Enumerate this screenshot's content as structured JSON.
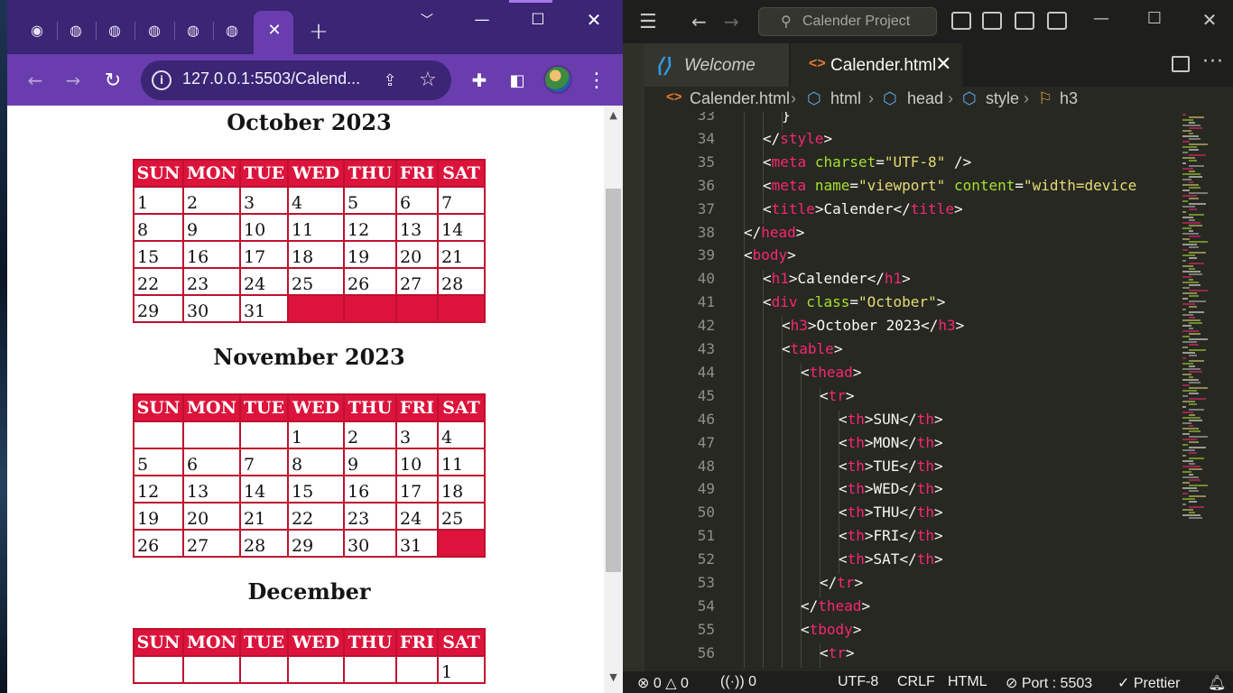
{
  "browser": {
    "tab_count_inactive": 5,
    "new_tab_label": "+",
    "url": "127.0.0.1:5503/Calend...",
    "icons": {
      "back": "arrow-left-icon",
      "forward": "arrow-right-icon",
      "reload": "reload-icon",
      "info": "info-icon",
      "share": "share-icon",
      "bookmark": "star-icon",
      "extensions": "puzzle-icon",
      "side_panel": "side-panel-icon",
      "menu": "kebab-icon"
    },
    "colors": {
      "tabstrip": "#3b2575",
      "toolbar": "#6a3dae"
    }
  },
  "page": {
    "accent": "#dc143c",
    "weekdays": [
      "SUN",
      "MON",
      "TUE",
      "WED",
      "THU",
      "FRI",
      "SAT"
    ],
    "months": [
      {
        "title": "October 2023",
        "weeks": [
          [
            "1",
            "2",
            "3",
            "4",
            "5",
            "6",
            "7"
          ],
          [
            "8",
            "9",
            "10",
            "11",
            "12",
            "13",
            "14"
          ],
          [
            "15",
            "16",
            "17",
            "18",
            "19",
            "20",
            "21"
          ],
          [
            "22",
            "23",
            "24",
            "25",
            "26",
            "27",
            "28"
          ],
          [
            "29",
            "30",
            "31",
            "",
            "",
            "",
            ""
          ]
        ]
      },
      {
        "title": "November 2023",
        "weeks": [
          [
            "",
            "",
            "",
            "1",
            "2",
            "3",
            "4"
          ],
          [
            "5",
            "6",
            "7",
            "8",
            "9",
            "10",
            "11"
          ],
          [
            "12",
            "13",
            "14",
            "15",
            "16",
            "17",
            "18"
          ],
          [
            "19",
            "20",
            "21",
            "22",
            "23",
            "24",
            "25"
          ],
          [
            "26",
            "27",
            "28",
            "29",
            "30",
            "31",
            ""
          ]
        ]
      },
      {
        "title": "December",
        "weeks": [
          [
            "",
            "",
            "",
            "",
            "",
            "",
            "1"
          ]
        ]
      }
    ]
  },
  "vscode": {
    "search_placeholder": "Calender Project",
    "tabs": [
      {
        "label": "Welcome",
        "active": false
      },
      {
        "label": "Calender.html",
        "active": true
      }
    ],
    "breadcrumbs": [
      "Calender.html",
      "html",
      "head",
      "style",
      "h3"
    ],
    "code_lines": [
      {
        "n": "33",
        "indent": 3,
        "tokens": [
          [
            "p",
            "}"
          ]
        ]
      },
      {
        "n": "34",
        "indent": 2,
        "tokens": [
          [
            "p",
            "</"
          ],
          [
            "t",
            "style"
          ],
          [
            "p",
            ">"
          ]
        ]
      },
      {
        "n": "35",
        "indent": 2,
        "tokens": [
          [
            "p",
            "<"
          ],
          [
            "t",
            "meta"
          ],
          [
            "p",
            " "
          ],
          [
            "a",
            "charset"
          ],
          [
            "p",
            "="
          ],
          [
            "s",
            "\"UTF-8\""
          ],
          [
            "p",
            " />"
          ]
        ]
      },
      {
        "n": "36",
        "indent": 2,
        "tokens": [
          [
            "p",
            "<"
          ],
          [
            "t",
            "meta"
          ],
          [
            "p",
            " "
          ],
          [
            "a",
            "name"
          ],
          [
            "p",
            "="
          ],
          [
            "s",
            "\"viewport\""
          ],
          [
            "p",
            " "
          ],
          [
            "a",
            "content"
          ],
          [
            "p",
            "="
          ],
          [
            "s",
            "\"width=device"
          ]
        ]
      },
      {
        "n": "37",
        "indent": 2,
        "tokens": [
          [
            "p",
            "<"
          ],
          [
            "t",
            "title"
          ],
          [
            "p",
            ">Calender</"
          ],
          [
            "t",
            "title"
          ],
          [
            "p",
            ">"
          ]
        ]
      },
      {
        "n": "38",
        "indent": 1,
        "tokens": [
          [
            "p",
            "</"
          ],
          [
            "t",
            "head"
          ],
          [
            "p",
            ">"
          ]
        ]
      },
      {
        "n": "39",
        "indent": 1,
        "tokens": [
          [
            "p",
            "<"
          ],
          [
            "t",
            "body"
          ],
          [
            "p",
            ">"
          ]
        ]
      },
      {
        "n": "40",
        "indent": 2,
        "tokens": [
          [
            "p",
            "<"
          ],
          [
            "t",
            "h1"
          ],
          [
            "p",
            ">Calender</"
          ],
          [
            "t",
            "h1"
          ],
          [
            "p",
            ">"
          ]
        ]
      },
      {
        "n": "41",
        "indent": 2,
        "tokens": [
          [
            "p",
            "<"
          ],
          [
            "t",
            "div"
          ],
          [
            "p",
            " "
          ],
          [
            "a",
            "class"
          ],
          [
            "p",
            "="
          ],
          [
            "s",
            "\"October\""
          ],
          [
            "p",
            ">"
          ]
        ]
      },
      {
        "n": "42",
        "indent": 3,
        "tokens": [
          [
            "p",
            "<"
          ],
          [
            "t",
            "h3"
          ],
          [
            "p",
            ">October 2023</"
          ],
          [
            "t",
            "h3"
          ],
          [
            "p",
            ">"
          ]
        ]
      },
      {
        "n": "43",
        "indent": 3,
        "tokens": [
          [
            "p",
            "<"
          ],
          [
            "t",
            "table"
          ],
          [
            "p",
            ">"
          ]
        ]
      },
      {
        "n": "44",
        "indent": 4,
        "tokens": [
          [
            "p",
            "<"
          ],
          [
            "t",
            "thead"
          ],
          [
            "p",
            ">"
          ]
        ]
      },
      {
        "n": "45",
        "indent": 5,
        "tokens": [
          [
            "p",
            "<"
          ],
          [
            "t",
            "tr"
          ],
          [
            "p",
            ">"
          ]
        ]
      },
      {
        "n": "46",
        "indent": 6,
        "tokens": [
          [
            "p",
            "<"
          ],
          [
            "t",
            "th"
          ],
          [
            "p",
            ">SUN</"
          ],
          [
            "t",
            "th"
          ],
          [
            "p",
            ">"
          ]
        ]
      },
      {
        "n": "47",
        "indent": 6,
        "tokens": [
          [
            "p",
            "<"
          ],
          [
            "t",
            "th"
          ],
          [
            "p",
            ">MON</"
          ],
          [
            "t",
            "th"
          ],
          [
            "p",
            ">"
          ]
        ]
      },
      {
        "n": "48",
        "indent": 6,
        "tokens": [
          [
            "p",
            "<"
          ],
          [
            "t",
            "th"
          ],
          [
            "p",
            ">TUE</"
          ],
          [
            "t",
            "th"
          ],
          [
            "p",
            ">"
          ]
        ]
      },
      {
        "n": "49",
        "indent": 6,
        "tokens": [
          [
            "p",
            "<"
          ],
          [
            "t",
            "th"
          ],
          [
            "p",
            ">WED</"
          ],
          [
            "t",
            "th"
          ],
          [
            "p",
            ">"
          ]
        ]
      },
      {
        "n": "50",
        "indent": 6,
        "tokens": [
          [
            "p",
            "<"
          ],
          [
            "t",
            "th"
          ],
          [
            "p",
            ">THU</"
          ],
          [
            "t",
            "th"
          ],
          [
            "p",
            ">"
          ]
        ]
      },
      {
        "n": "51",
        "indent": 6,
        "tokens": [
          [
            "p",
            "<"
          ],
          [
            "t",
            "th"
          ],
          [
            "p",
            ">FRI</"
          ],
          [
            "t",
            "th"
          ],
          [
            "p",
            ">"
          ]
        ]
      },
      {
        "n": "52",
        "indent": 6,
        "tokens": [
          [
            "p",
            "<"
          ],
          [
            "t",
            "th"
          ],
          [
            "p",
            ">SAT</"
          ],
          [
            "t",
            "th"
          ],
          [
            "p",
            ">"
          ]
        ]
      },
      {
        "n": "53",
        "indent": 5,
        "tokens": [
          [
            "p",
            "</"
          ],
          [
            "t",
            "tr"
          ],
          [
            "p",
            ">"
          ]
        ]
      },
      {
        "n": "54",
        "indent": 4,
        "tokens": [
          [
            "p",
            "</"
          ],
          [
            "t",
            "thead"
          ],
          [
            "p",
            ">"
          ]
        ]
      },
      {
        "n": "55",
        "indent": 4,
        "tokens": [
          [
            "p",
            "<"
          ],
          [
            "t",
            "tbody"
          ],
          [
            "p",
            ">"
          ]
        ]
      },
      {
        "n": "56",
        "indent": 5,
        "tokens": [
          [
            "p",
            "<"
          ],
          [
            "t",
            "tr"
          ],
          [
            "p",
            ">"
          ]
        ]
      }
    ],
    "status": {
      "errors": "0",
      "warnings": "0",
      "ports": "0",
      "encoding": "UTF-8",
      "eol": "CRLF",
      "language": "HTML",
      "port": "Port : 5503",
      "formatter": "Prettier"
    },
    "colors": {
      "tag": "#f92672",
      "attr": "#a6e22e",
      "string": "#e6db74",
      "editor_bg": "#272822"
    }
  }
}
